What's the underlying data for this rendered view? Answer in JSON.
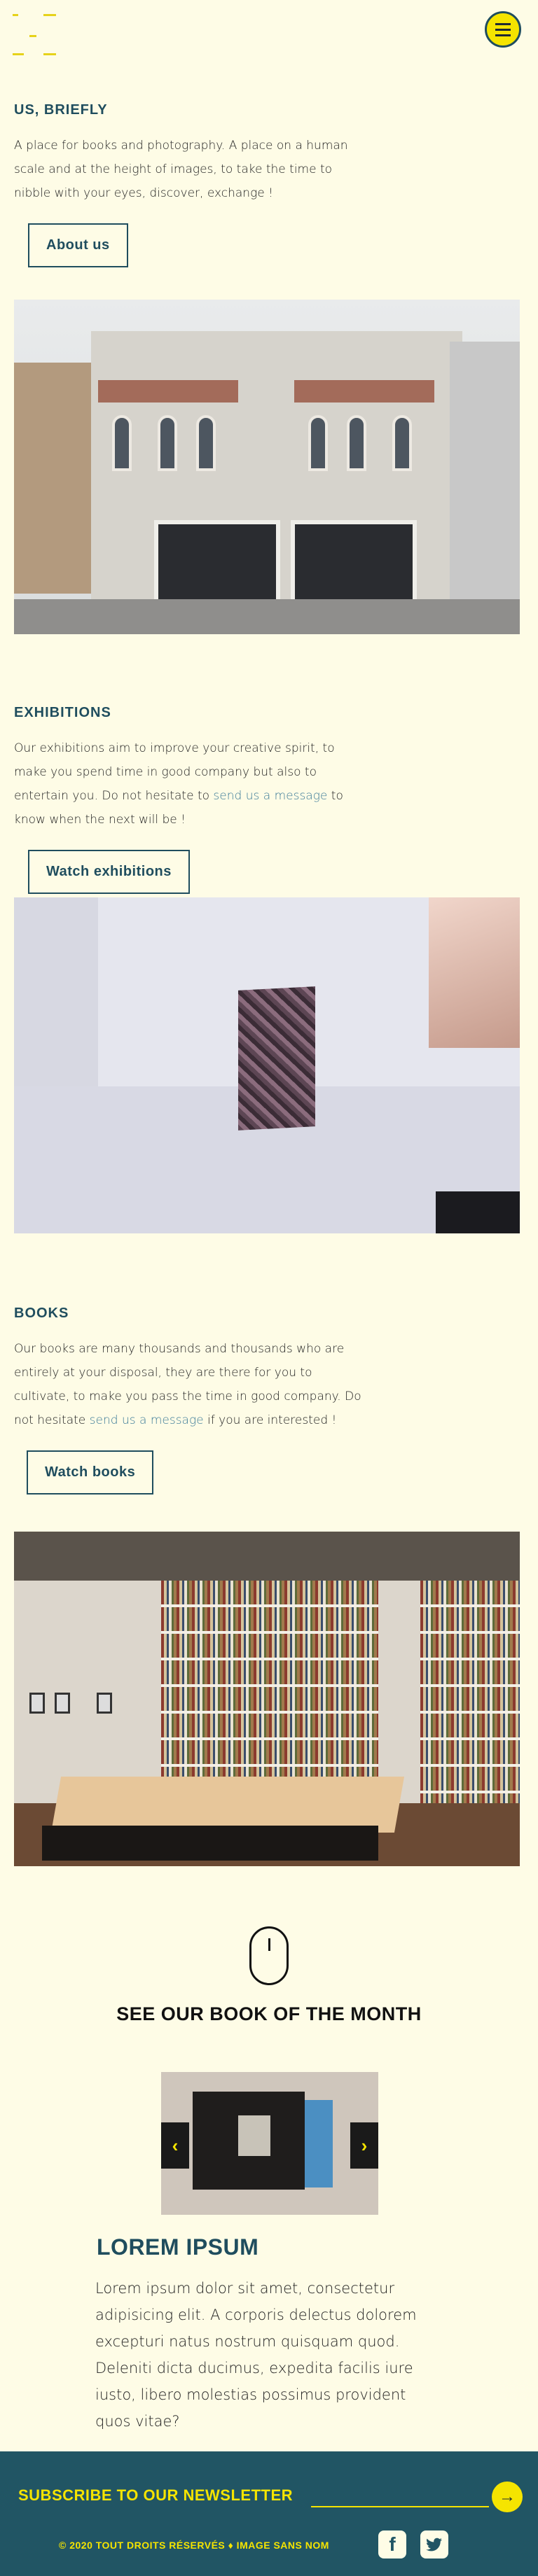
{
  "colors": {
    "background": "#fefce6",
    "accent_yellow": "#f5e400",
    "heading_teal": "#1f4d5e",
    "link_blue": "#3d7c99",
    "footer_bg": "#215564"
  },
  "header": {
    "logo_icon": "logo-mark",
    "menu_icon": "hamburger-icon"
  },
  "about": {
    "title": "US, BRIEFLY",
    "text": "A place for books and photography. A place on a human scale and at the height of images, to take the time to nibble with your eyes, discover, exchange !",
    "button": "About us"
  },
  "exhibitions": {
    "title": "EXHIBITIONS",
    "text_before": "Our exhibitions aim to improve your creative spirit, to make you spend time in good company but also to entertain you. Do not hesitate to ",
    "link": "send us a message",
    "text_after": " to know when the next will be !",
    "button": "Watch exhibitions"
  },
  "books": {
    "title": "BOOKS",
    "text_before": "Our books are many thousands and thousands who are entirely at your disposal, they are there for you to cultivate, to make you pass the time in good company. Do not hesitate ",
    "link": "send us a message",
    "text_after": " if you are interested !",
    "button": "Watch books"
  },
  "book_of_month": {
    "scroll_icon": "mouse-scroll-icon",
    "title": "SEE OUR BOOK OF THE MONTH",
    "prev_icon": "chevron-left-icon",
    "next_icon": "chevron-right-icon",
    "prev": "‹",
    "next": "›",
    "book_title": "LOREM IPSUM",
    "book_text": "Lorem ipsum dolor sit amet, consectetur adipisicing elit. A corporis delectus dolorem excepturi natus nostrum quisquam quod. Deleniti dicta ducimus, expedita facilis iure iusto, libero molestias possimus provident quos vitae?"
  },
  "footer": {
    "newsletter_title": "SUBSCRIBE TO OUR NEWSLETTER",
    "newsletter_placeholder": "",
    "submit_icon": "arrow-right-icon",
    "submit": "→",
    "copyright": "© 2020 TOUT DROITS RÉSERVÉS ♦ IMAGE SANS NOM",
    "facebook_icon": "facebook-icon",
    "facebook": "f",
    "twitter_icon": "twitter-icon"
  }
}
